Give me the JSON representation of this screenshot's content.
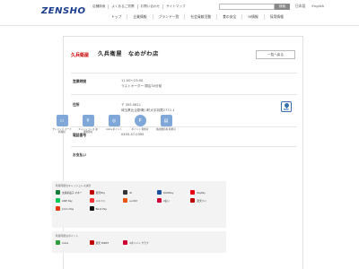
{
  "site": {
    "logo": "ZENSHO",
    "util_links": [
      "店舗検索",
      "よくあるご質問",
      "お問い合わせ",
      "サイトマップ"
    ],
    "search_placeholder": "",
    "search_button": "検索",
    "lang_ja": "日本語",
    "lang_en": "English"
  },
  "nav": [
    "トップ",
    "企業情報",
    "ブランド一覧",
    "社会貢献活動",
    "食の安全",
    "IR情報",
    "採用情報"
  ],
  "store": {
    "brand_logo_text": "久兵衛屋",
    "name": "久兵衛屋　なめがわ店",
    "back_button": "一覧へ戻る",
    "hours_label": "営業時間",
    "hours_line1": "11:00～23:00",
    "hours_line2": "ラストオーダー 閉店30分前",
    "address_label": "住所",
    "address_line1": "〒 355-0811",
    "address_line2": "埼玉県比企郡滑川町大字羽尾2772-1",
    "map_label": "MAP",
    "phone_label": "電話番号",
    "phone": "0493-57-0395",
    "payment_label": "お支払い"
  },
  "payment_cards": [
    {
      "icon": "credit-card-icon",
      "caption": "クレジット\nカード利用可"
    },
    {
      "icon": "cashless-icon",
      "caption": "キャッシュレス\n決済利用可"
    },
    {
      "icon": "coca-icon",
      "caption": "CoCa\nポイント"
    },
    {
      "icon": "point-icon",
      "caption": "ポイント\n利用可"
    },
    {
      "icon": "coupon-icon",
      "caption": "株主優待券\n利用可"
    }
  ],
  "cashless": {
    "title": "利用可能なキャッシュレス決済",
    "brands": [
      {
        "name": "交通系電子\nマネー",
        "color": "#1b7c3a"
      },
      {
        "name": "楽天Edy",
        "color": "#bf0000"
      },
      {
        "name": "iD",
        "color": "#333333"
      },
      {
        "name": "QUICPay",
        "color": "#1f4fa0"
      },
      {
        "name": "PayPay",
        "color": "#e60012"
      },
      {
        "name": "LINE Pay",
        "color": "#06c755"
      },
      {
        "name": "メルペイ",
        "color": "#ff3333"
      },
      {
        "name": "au PAY",
        "color": "#eb5505"
      },
      {
        "name": "d払い",
        "color": "#cc0033"
      },
      {
        "name": "楽天ペイ",
        "color": "#bf0000"
      },
      {
        "name": "J-Coin Pay",
        "color": "#e7380d"
      },
      {
        "name": "Bank Pay",
        "color": "#111111"
      }
    ]
  },
  "points": {
    "title": "利用可能なポイント",
    "brands": [
      {
        "name": "CoCa",
        "color": "#2e9e3f"
      },
      {
        "name": "楽天\nPOINT",
        "color": "#bf0000"
      },
      {
        "name": "dポイント\nクラブ",
        "color": "#cc0033"
      }
    ]
  }
}
